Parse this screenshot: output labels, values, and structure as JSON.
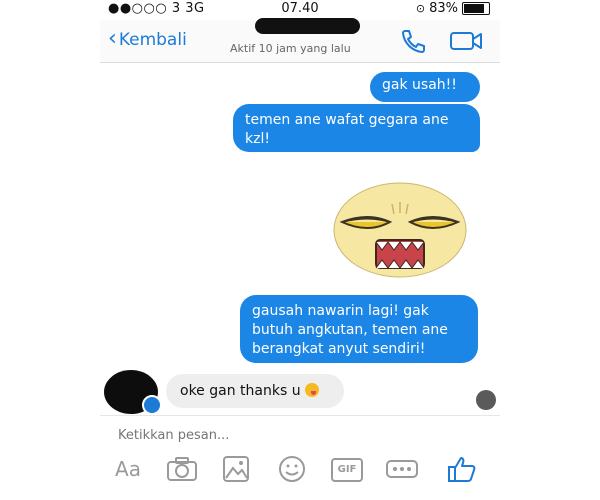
{
  "status_bar": {
    "signal": "●●○○○ 3  3G",
    "time": "07.40",
    "battery": "83%",
    "battery_level": 0.83
  },
  "nav": {
    "back_label": "Kembali",
    "subtitle": "Aktif 10 jam yang lalu",
    "icons": [
      "phone-icon",
      "video-call-icon"
    ]
  },
  "messages": [
    {
      "from": "me",
      "text": "gak usah!!"
    },
    {
      "from": "me",
      "text": "temen ane wafat gegara ane kzl!"
    },
    {
      "from": "me",
      "type": "sticker",
      "sticker": "annoyed-face-sticker"
    },
    {
      "from": "me",
      "text": "gausah nawarin lagi! gak butuh angkutan, temen ane berangkat anyut sendiri!"
    },
    {
      "from": "them",
      "text": "oke gan thanks u"
    }
  ],
  "composer": {
    "placeholder": "Ketikkan pesan...",
    "aa_label": "Aa",
    "gif_label": "GIF",
    "icons": [
      "camera-icon",
      "gallery-icon",
      "emoji-icon",
      "gif-icon",
      "more-icon",
      "like-icon"
    ]
  },
  "colors": {
    "accent": "#1d7bd6",
    "bubble_out": "#1b86e6",
    "bubble_in": "#eeeeee"
  }
}
